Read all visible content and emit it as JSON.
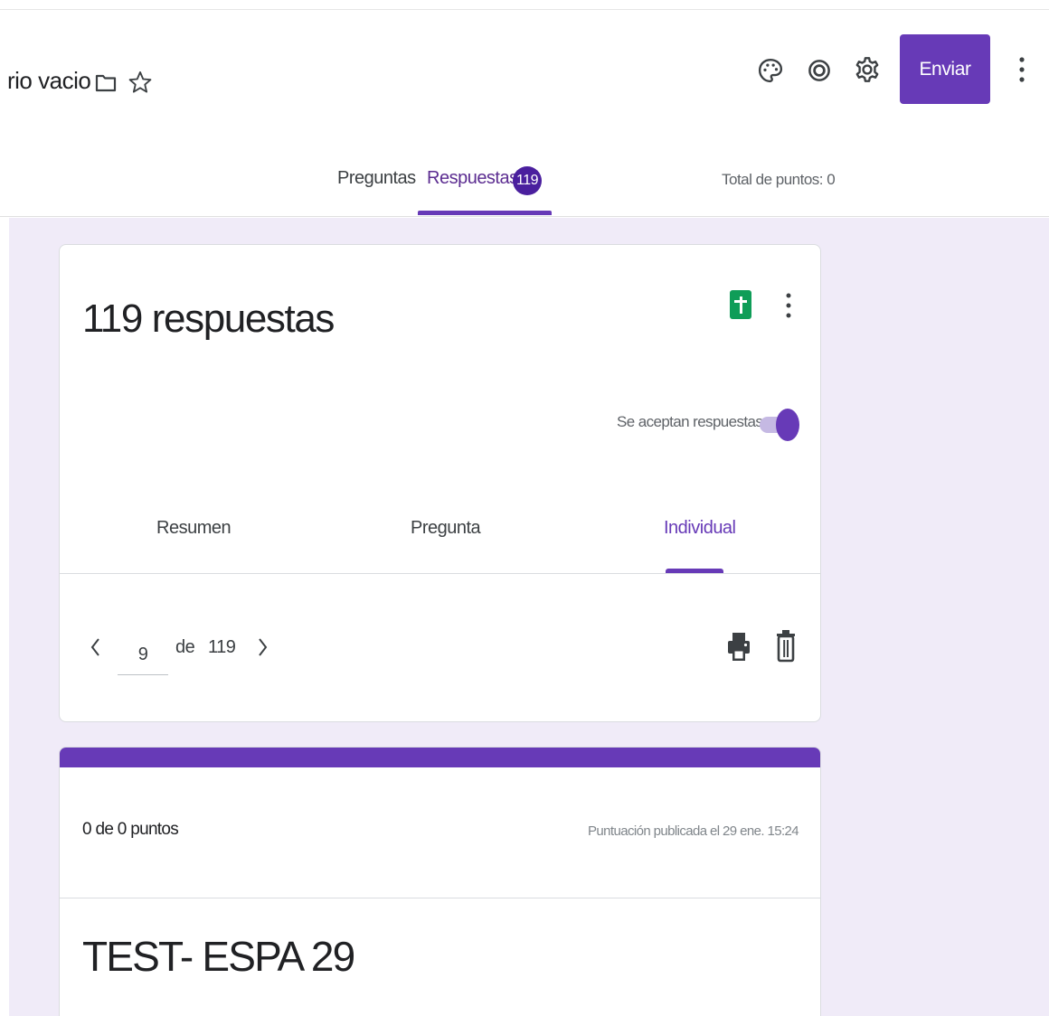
{
  "header": {
    "doc_title": "rio vacio",
    "send_label": "Enviar",
    "tabs": [
      {
        "label": "Preguntas"
      },
      {
        "label": "Respuestas",
        "badge": "119"
      }
    ],
    "total_points": "Total de puntos: 0"
  },
  "summary": {
    "title": "119 respuestas",
    "accepting_label": "Se aceptan respuestas",
    "accepting_on": true,
    "subtabs": [
      {
        "label": "Resumen"
      },
      {
        "label": "Pregunta"
      },
      {
        "label": "Individual"
      }
    ],
    "active_subtab": "Individual",
    "pager": {
      "current": "9",
      "de_label": "de",
      "total": "119"
    }
  },
  "response": {
    "score": "0 de 0 puntos",
    "published": "Puntuación publicada el 29 ene. 15:24",
    "form_title": "TEST- ESPA 29"
  },
  "colors": {
    "accent": "#673ab7",
    "badge": "#4a1f9e",
    "background": "#f0ebf8",
    "sheets_green": "#0f9d58"
  },
  "icons": [
    "folder-icon",
    "star-icon",
    "palette-icon",
    "preview-icon",
    "settings-icon",
    "more-vert-icon",
    "sheets-icon",
    "chevron-left-icon",
    "chevron-right-icon",
    "print-icon",
    "delete-icon"
  ]
}
